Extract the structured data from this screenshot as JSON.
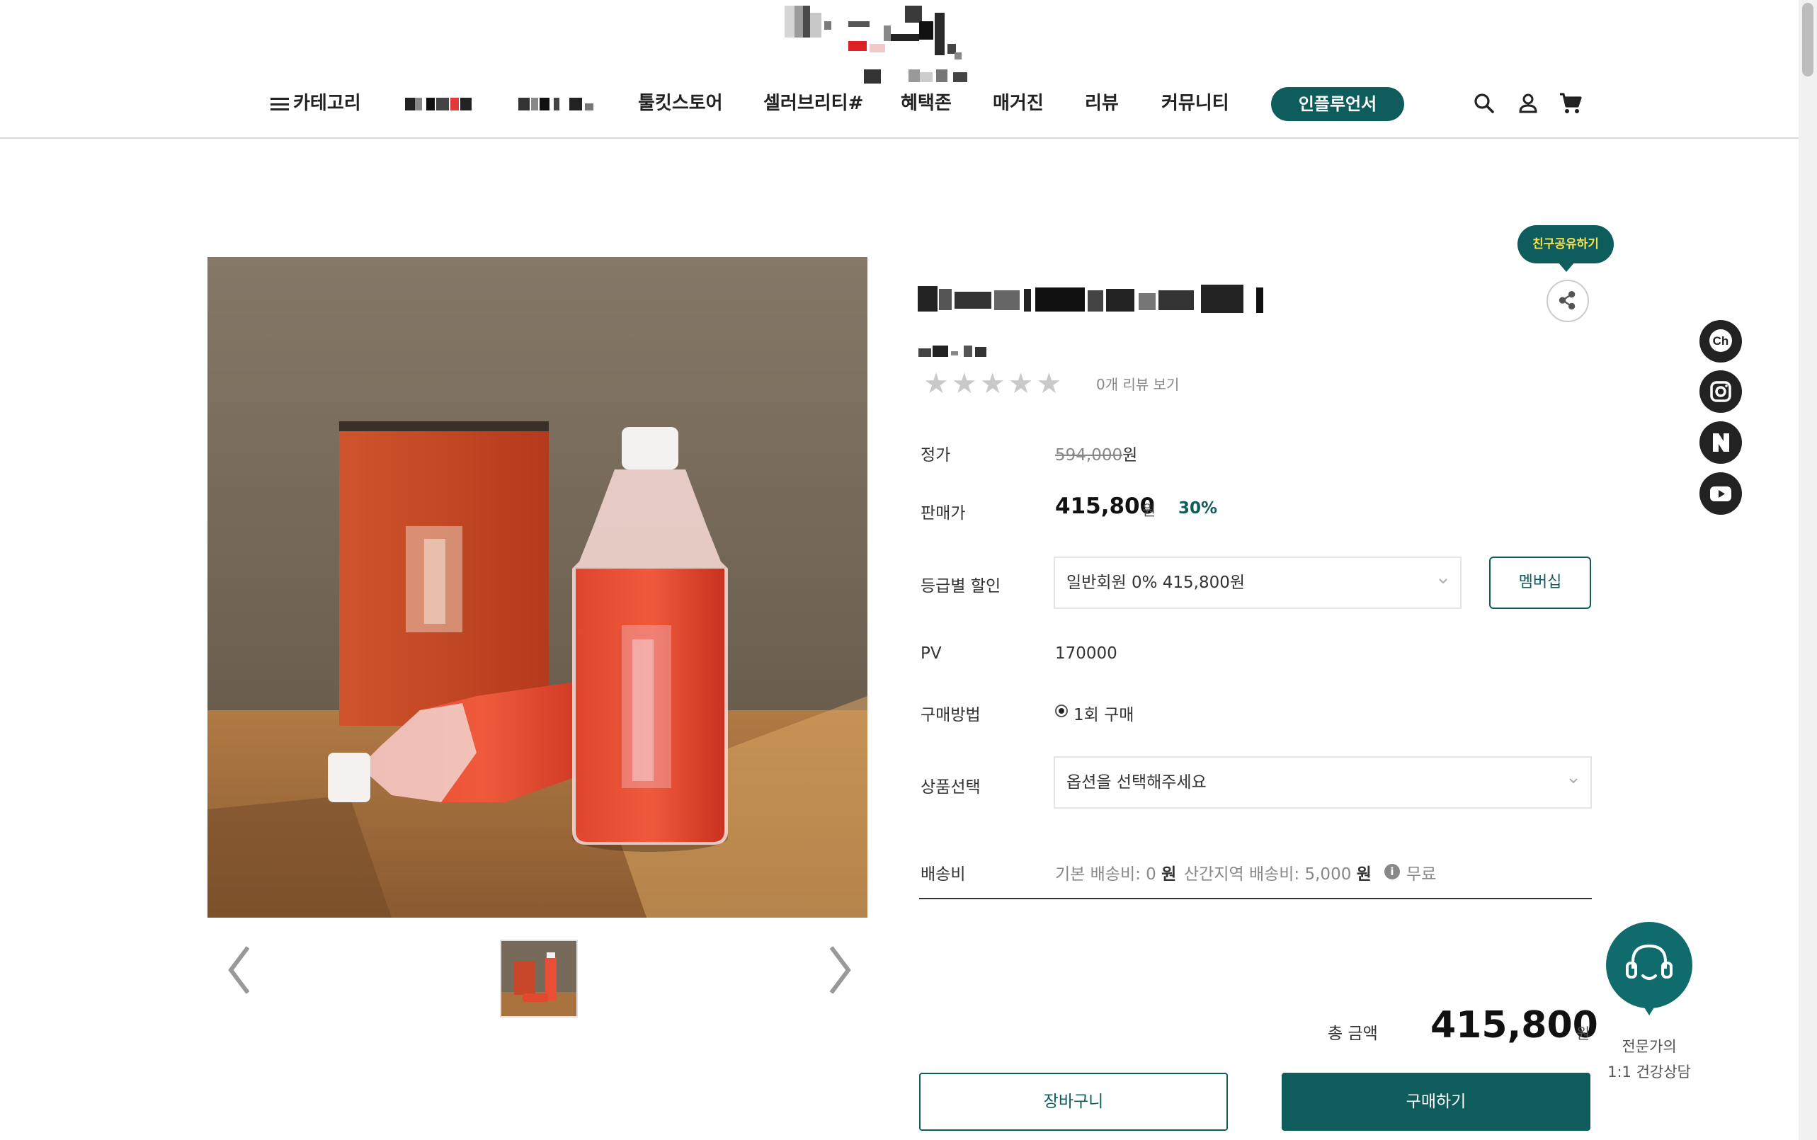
{
  "header": {
    "nav": {
      "category": "카테고리",
      "toolkit_store": "툴킷스토어",
      "celebrity": "셀러브리티#",
      "benefits": "혜택존",
      "magazine": "매거진",
      "review": "리뷰",
      "community": "커뮤니티",
      "influencer": "인플루언서"
    },
    "icons": [
      "search-icon",
      "user-icon",
      "cart-icon"
    ]
  },
  "product": {
    "review_link": "0개 리뷰 보기",
    "rating_stars": 0,
    "share_tooltip": "친구공유하기",
    "rows": {
      "list_price_label": "정가",
      "list_price": "594,000",
      "list_price_unit": "원",
      "sale_price_label": "판매가",
      "sale_price": "415,800",
      "sale_price_unit": "원",
      "discount": "30%",
      "grade_discount_label": "등급별 할인",
      "grade_discount_value": "일반회원 0% 415,800원",
      "membership_button": "멤버십",
      "pv_label": "PV",
      "pv_value": "170000",
      "purchase_method_label": "구매방법",
      "purchase_method_value": "1회 구매",
      "option_label": "상품선택",
      "option_placeholder": "옵션을 선택해주세요",
      "shipping_label": "배송비",
      "shipping_basic": "기본 배송비: 0",
      "shipping_basic_unit": "원",
      "shipping_mountain": "산간지역 배송비: 5,000",
      "shipping_mountain_unit": "원",
      "shipping_free": "무료"
    },
    "total_label": "총 금액",
    "total_value": "415,800",
    "total_unit": "원",
    "cart_button": "장바구니",
    "buy_button": "구매하기"
  },
  "side": {
    "social": [
      "Ch",
      "instagram-icon",
      "N",
      "youtube-icon"
    ],
    "consult_line1": "전문가의",
    "consult_line2": "1:1 건강상담"
  },
  "colors": {
    "brand": "#0f5c5d",
    "tooltip_text": "#f7e14b"
  }
}
